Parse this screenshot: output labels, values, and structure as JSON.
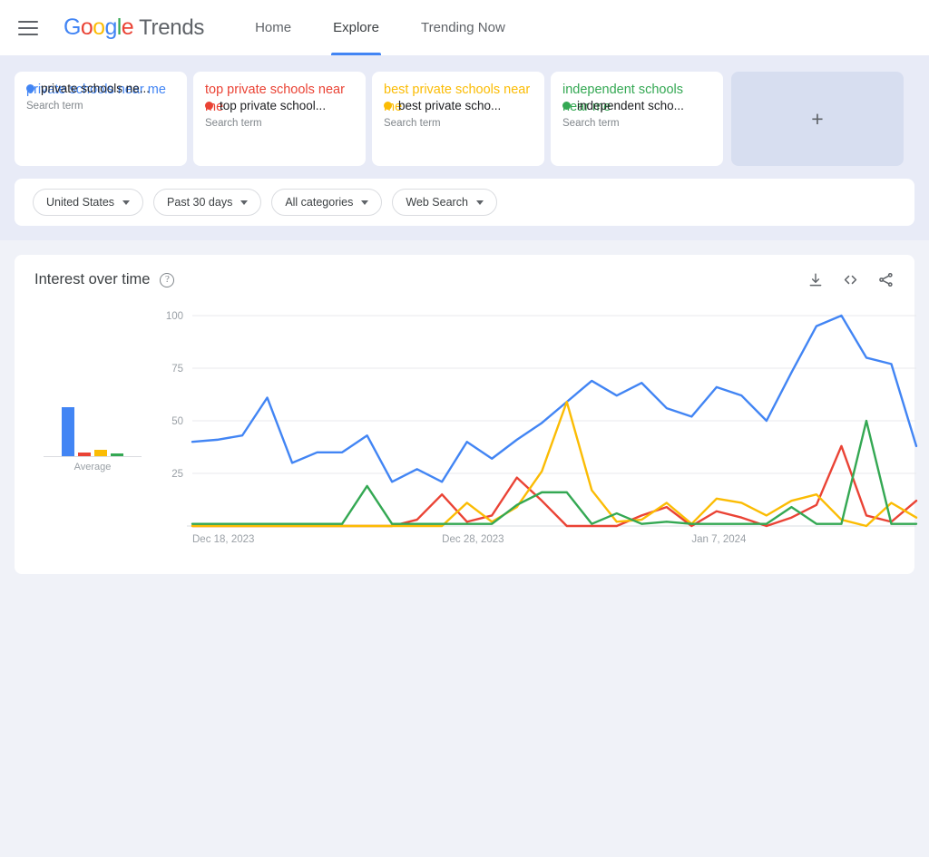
{
  "header": {
    "menu_icon": "hamburger-icon",
    "logo_letters": [
      "G",
      "o",
      "o",
      "g",
      "l",
      "e"
    ],
    "product": "Trends",
    "nav": [
      {
        "label": "Home",
        "active": false
      },
      {
        "label": "Explore",
        "active": true
      },
      {
        "label": "Trending Now",
        "active": false
      }
    ]
  },
  "terms": {
    "cards": [
      {
        "title": "private schools near me",
        "short": "private schools ne...",
        "type": "Search term",
        "color": "#4285F4"
      },
      {
        "title": "top private schools near me",
        "short": "top private school...",
        "type": "Search term",
        "color": "#EA4335"
      },
      {
        "title": "best private schools near me",
        "short": "best private scho...",
        "type": "Search term",
        "color": "#FBBC04"
      },
      {
        "title": "independent schools near me",
        "short": "independent scho...",
        "type": "Search term",
        "color": "#34A853"
      }
    ],
    "add_label": "+"
  },
  "filters": [
    {
      "label": "United States"
    },
    {
      "label": "Past 30 days"
    },
    {
      "label": "All categories"
    },
    {
      "label": "Web Search"
    }
  ],
  "chart_card": {
    "title": "Interest over time",
    "help": "?",
    "actions": [
      {
        "name": "download-icon"
      },
      {
        "name": "embed-icon"
      },
      {
        "name": "share-icon"
      }
    ]
  },
  "chart_data": {
    "type": "line",
    "title": "Interest over time",
    "xlabel": "",
    "ylabel": "",
    "ylim": [
      0,
      100
    ],
    "yticks": [
      25,
      50,
      75,
      100
    ],
    "grid": true,
    "legend_position": "cards-above",
    "x_tick_labels": [
      "Dec 18, 2023",
      "Dec 28, 2023",
      "Jan 7, 2024"
    ],
    "x_tick_indices": [
      0,
      10,
      20
    ],
    "x": [
      "Dec 18, 2023",
      "Dec 19, 2023",
      "Dec 20, 2023",
      "Dec 21, 2023",
      "Dec 22, 2023",
      "Dec 23, 2023",
      "Dec 24, 2023",
      "Dec 25, 2023",
      "Dec 26, 2023",
      "Dec 27, 2023",
      "Dec 28, 2023",
      "Dec 29, 2023",
      "Dec 30, 2023",
      "Dec 31, 2023",
      "Jan 1, 2024",
      "Jan 2, 2024",
      "Jan 3, 2024",
      "Jan 4, 2024",
      "Jan 5, 2024",
      "Jan 6, 2024",
      "Jan 7, 2024",
      "Jan 8, 2024",
      "Jan 9, 2024",
      "Jan 10, 2024",
      "Jan 11, 2024",
      "Jan 12, 2024",
      "Jan 13, 2024",
      "Jan 14, 2024",
      "Jan 15, 2024",
      "Jan 16, 2024"
    ],
    "series": [
      {
        "name": "private schools near me",
        "color": "#4285F4",
        "average": 49,
        "values": [
          40,
          41,
          43,
          61,
          30,
          35,
          35,
          43,
          21,
          27,
          21,
          40,
          32,
          41,
          49,
          59,
          69,
          62,
          68,
          56,
          52,
          66,
          62,
          50,
          73,
          95,
          100,
          80,
          77,
          38
        ]
      },
      {
        "name": "top private schools near me",
        "color": "#EA4335",
        "average": 4,
        "values": [
          0,
          0,
          0,
          0,
          0,
          0,
          0,
          0,
          0,
          3,
          15,
          2,
          5,
          23,
          12,
          0,
          0,
          0,
          5,
          9,
          0,
          7,
          4,
          0,
          4,
          10,
          38,
          5,
          2,
          12
        ]
      },
      {
        "name": "best private schools near me",
        "color": "#FBBC04",
        "average": 6,
        "values": [
          0,
          0,
          0,
          0,
          0,
          0,
          0,
          0,
          0,
          0,
          0,
          11,
          2,
          9,
          26,
          59,
          17,
          2,
          3,
          11,
          1,
          13,
          11,
          5,
          12,
          15,
          3,
          0,
          11,
          4
        ]
      },
      {
        "name": "independent schools near me",
        "color": "#34A853",
        "average": 3,
        "values": [
          1,
          1,
          1,
          1,
          1,
          1,
          1,
          19,
          1,
          1,
          1,
          1,
          1,
          10,
          16,
          16,
          1,
          6,
          1,
          2,
          1,
          1,
          1,
          1,
          9,
          1,
          1,
          50,
          1,
          1
        ]
      }
    ],
    "average_label": "Average"
  }
}
